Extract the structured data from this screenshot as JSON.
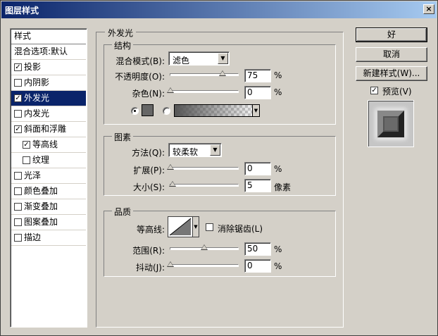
{
  "window": {
    "title": "图层样式",
    "close_glyph": "×"
  },
  "sidebar": {
    "header": "样式",
    "items": [
      {
        "label": "混合选项:默认",
        "checkbox": false,
        "checked": false
      },
      {
        "label": "投影",
        "checkbox": true,
        "checked": true
      },
      {
        "label": "内阴影",
        "checkbox": true,
        "checked": false
      },
      {
        "label": "外发光",
        "checkbox": true,
        "checked": true,
        "selected": true
      },
      {
        "label": "内发光",
        "checkbox": true,
        "checked": false
      },
      {
        "label": "斜面和浮雕",
        "checkbox": true,
        "checked": true
      },
      {
        "label": "等高线",
        "checkbox": true,
        "checked": true,
        "indent": true
      },
      {
        "label": "纹理",
        "checkbox": true,
        "checked": false,
        "indent": true
      },
      {
        "label": "光泽",
        "checkbox": true,
        "checked": false
      },
      {
        "label": "颜色叠加",
        "checkbox": true,
        "checked": false
      },
      {
        "label": "渐变叠加",
        "checkbox": true,
        "checked": false
      },
      {
        "label": "图案叠加",
        "checkbox": true,
        "checked": false
      },
      {
        "label": "描边",
        "checkbox": true,
        "checked": false
      }
    ]
  },
  "panel": {
    "title": "外发光",
    "structure": {
      "title": "结构",
      "blend_mode_label": "混合模式(B):",
      "blend_mode_value": "滤色",
      "opacity_label": "不透明度(O):",
      "opacity_value": "75",
      "opacity_unit": "%",
      "opacity_level": 0.75,
      "noise_label": "杂色(N):",
      "noise_value": "0",
      "noise_unit": "%",
      "color_mode": "solid"
    },
    "elements": {
      "title": "图素",
      "technique_label": "方法(Q):",
      "technique_value": "较柔软",
      "spread_label": "扩展(P):",
      "spread_value": "0",
      "spread_unit": "%",
      "size_label": "大小(S):",
      "size_value": "5",
      "size_unit": "像素"
    },
    "quality": {
      "title": "品质",
      "contour_label": "等高线:",
      "antialias_label": "消除锯齿(L)",
      "antialias_checked": false,
      "range_label": "范围(R):",
      "range_value": "50",
      "range_unit": "%",
      "jitter_label": "抖动(J):",
      "jitter_value": "0",
      "jitter_unit": "%"
    }
  },
  "buttons": {
    "ok": "好",
    "cancel": "取消",
    "new_style": "新建样式(W)...",
    "preview_label": "预览(V)",
    "preview_checked": true
  },
  "colors": {
    "selection": "#0a246a",
    "glow_swatch": "#666666",
    "dialog_bg": "#d4d0c8"
  }
}
